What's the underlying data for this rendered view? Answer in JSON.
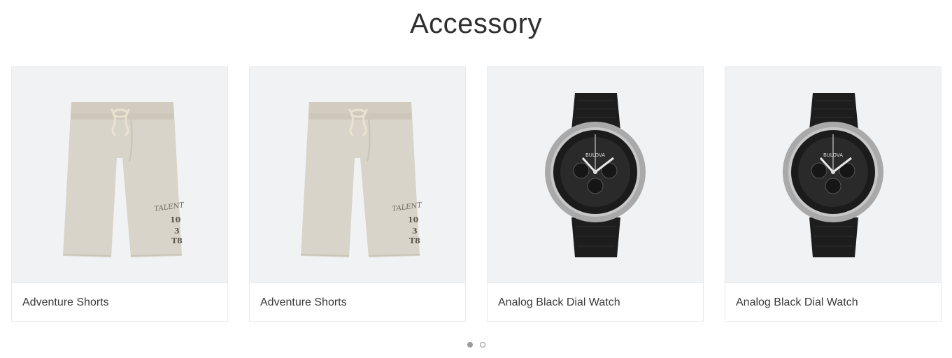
{
  "section": {
    "title": "Accessory"
  },
  "products": [
    {
      "name": "Adventure Shorts",
      "image_icon": "shorts-image"
    },
    {
      "name": "Adventure Shorts",
      "image_icon": "shorts-image"
    },
    {
      "name": "Analog Black Dial Watch",
      "image_icon": "watch-image"
    },
    {
      "name": "Analog Black Dial Watch",
      "image_icon": "watch-image"
    }
  ],
  "watch_brand": "BULOVA",
  "shorts_print": "TALENT",
  "pagination": {
    "pages": 2,
    "active_page": 1
  },
  "colors": {
    "image_background": "#f1f2f4",
    "dot_active": "#9a9a9a",
    "card_border": "#e7e9ec"
  }
}
